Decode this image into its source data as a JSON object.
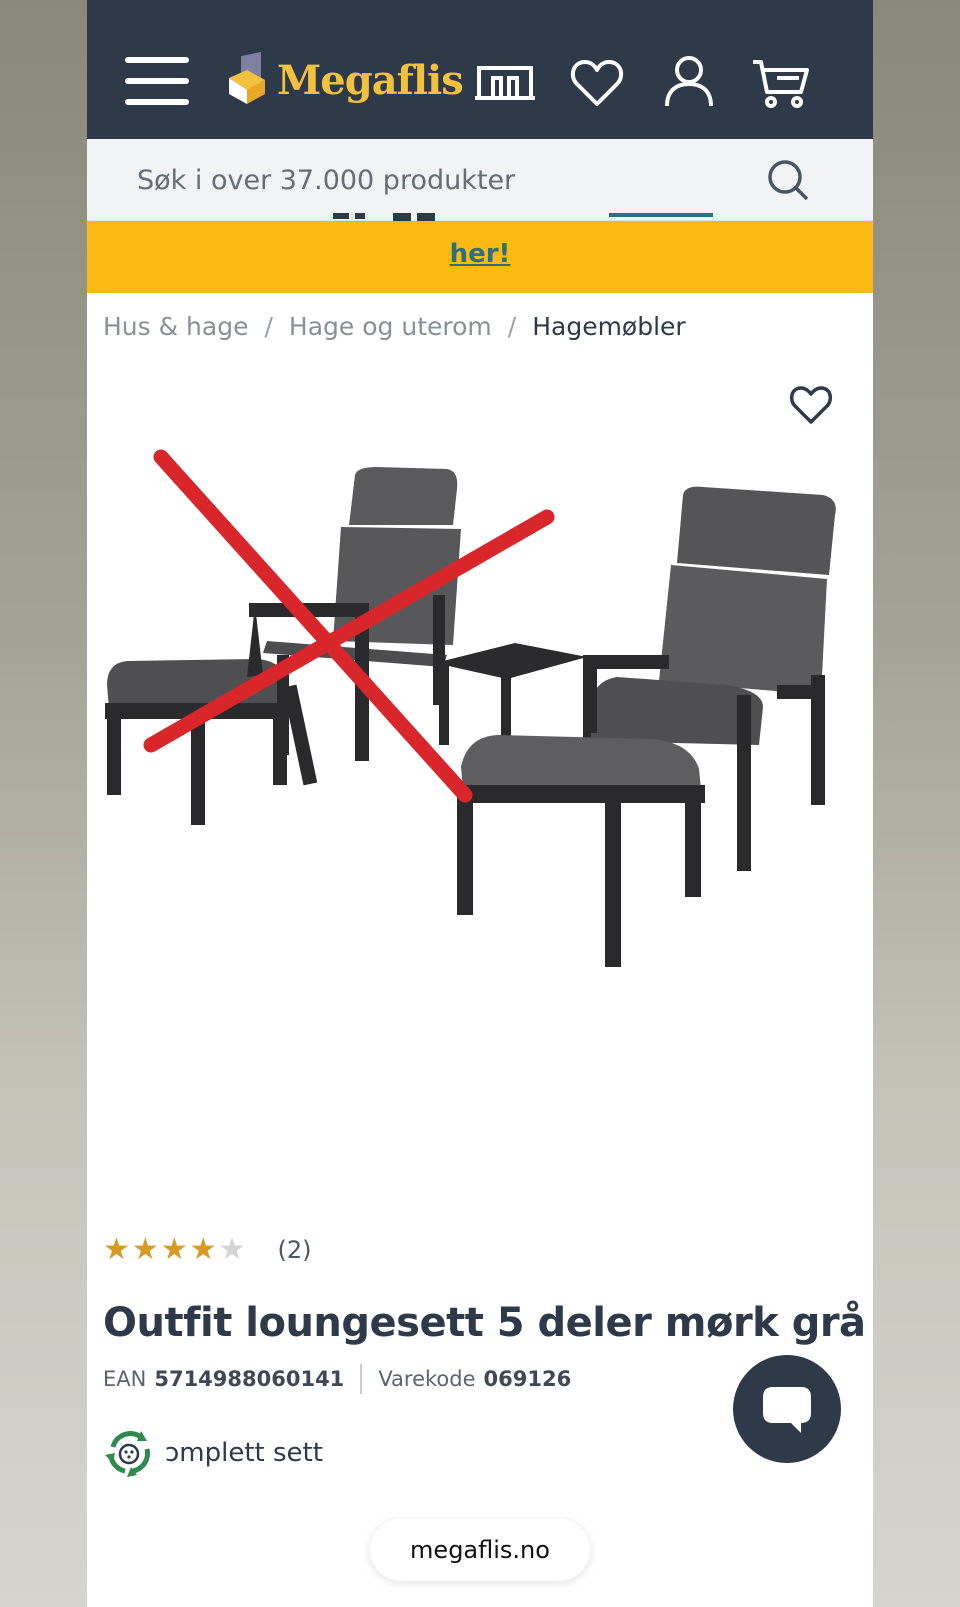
{
  "header": {
    "logo_text": "Megaflis",
    "icons": [
      "menu-icon",
      "store-icon",
      "heart-icon",
      "user-icon",
      "cart-icon"
    ],
    "background_color": "#2e3a4a",
    "logo_color": "#f3c23d"
  },
  "search": {
    "placeholder": "Søk i over 37.000 produkter"
  },
  "banner": {
    "link_text": "her!",
    "background_color": "#fdb913"
  },
  "breadcrumb": {
    "items": [
      "Hus & hage",
      "Hage og uterom",
      "Hagemøbler"
    ]
  },
  "product": {
    "rating": 4,
    "rating_max": 5,
    "review_count": "(2)",
    "title": "Outfit loungesett 5 deler mørk grå",
    "ean_label": "EAN",
    "ean_value": "5714988060141",
    "varekode_label": "Varekode",
    "varekode_value": "069126",
    "badge_text": "ɔmplett sett"
  },
  "browser": {
    "url": "megaflis.no"
  }
}
